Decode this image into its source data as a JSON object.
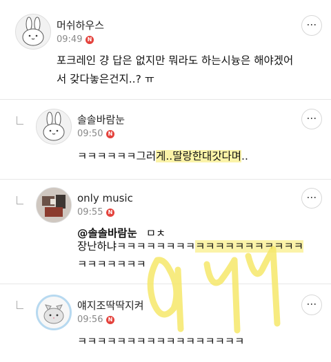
{
  "comments": [
    {
      "nickname": "머쉬하우스",
      "time": "09:49",
      "badge": "N",
      "lines": [
        "포크레인 걍 답은 없지만 뭐라도 하는시늉은 해야겠어",
        "서 갖다놓은건지..? ㅠ"
      ],
      "avatar_icon": "bunny-avatar-icon"
    },
    {
      "nickname": "솔솔바람눈",
      "time": "09:50",
      "badge": "N",
      "text_plain": "ㅋㅋㅋㅋㅋㅋ그러",
      "text_highlight": "게..딸랑한대갓다며",
      "text_tail": "..",
      "avatar_icon": "bunny-avatar-icon"
    },
    {
      "nickname": "only music",
      "time": "09:55",
      "badge": "N",
      "mention": "@솔솔바람눈",
      "mention_suffix": "ㅁㅊ",
      "line2_plain": "장난하냐ㅋㅋㅋㅋㅋㅋㅋㅋ",
      "line2_highlight": "ㅋㅋㅋㅋㅋㅋㅋㅋㅋㅋㅋ",
      "line3": "ㅋㅋㅋㅋㅋㅋㅋ",
      "avatar_icon": "photo-avatar-icon"
    },
    {
      "nickname": "얘지조딱딱지켜",
      "time": "09:56",
      "badge": "N",
      "text": "ㅋㅋㅋㅋㅋㅋㅋㅋㅋㅋㅋㅋㅋㅋㅋㅋㅋ",
      "avatar_icon": "cat-avatar-icon"
    }
  ],
  "more_glyph": "⋯",
  "colors": {
    "badge": "#e4423c",
    "highlight": "#fbf3a8",
    "scribble": "#f6e86a"
  }
}
